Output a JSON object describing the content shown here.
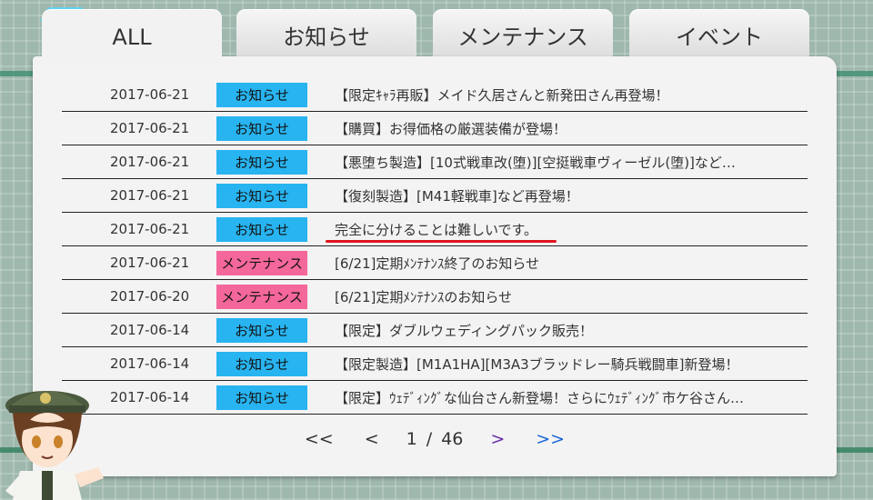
{
  "tabs": [
    {
      "label": "ALL",
      "active": true
    },
    {
      "label": "お知らせ",
      "active": false
    },
    {
      "label": "メンテナンス",
      "active": false
    },
    {
      "label": "イベント",
      "active": false
    }
  ],
  "news": [
    {
      "date": "2017-06-21",
      "category": "お知らせ",
      "type": "info",
      "title": "【限定ｷｬﾗ再販】メイド久居さんと新発田さん再登場！"
    },
    {
      "date": "2017-06-21",
      "category": "お知らせ",
      "type": "info",
      "title": "【購買】お得価格の厳選装備が登場！"
    },
    {
      "date": "2017-06-21",
      "category": "お知らせ",
      "type": "info",
      "title": "【悪堕ち製造】[10式戦車改(堕)][空挺戦車ヴィーゼル(堕)]など…"
    },
    {
      "date": "2017-06-21",
      "category": "お知らせ",
      "type": "info",
      "title": "【復刻製造】[M41軽戦車]など再登場！"
    },
    {
      "date": "2017-06-21",
      "category": "お知らせ",
      "type": "info",
      "title": "完全に分けることは難しいです。"
    },
    {
      "date": "2017-06-21",
      "category": "メンテナンス",
      "type": "maint",
      "title": "[6/21]定期ﾒﾝﾃﾅﾝｽ終了のお知らせ"
    },
    {
      "date": "2017-06-20",
      "category": "メンテナンス",
      "type": "maint",
      "title": "[6/21]定期ﾒﾝﾃﾅﾝｽのお知らせ"
    },
    {
      "date": "2017-06-14",
      "category": "お知らせ",
      "type": "info",
      "title": "【限定】ダブルウェディングパック販売！"
    },
    {
      "date": "2017-06-14",
      "category": "お知らせ",
      "type": "info",
      "title": "【限定製造】[M1A1HA][M3A3ブラッドレー騎兵戦闘車]新登場！"
    },
    {
      "date": "2017-06-14",
      "category": "お知らせ",
      "type": "info",
      "title": "【限定】ｳｪﾃﾞｨﾝｸﾞな仙台さん新登場！さらにｳｪﾃﾞｨﾝｸﾞ市ケ谷さん…"
    }
  ],
  "pager": {
    "first": "<<",
    "prev": "<",
    "current": "1",
    "separator": "/",
    "total": "46",
    "next": ">",
    "last": ">>"
  },
  "colors": {
    "info_badge": "#28b4f0",
    "maint_badge": "#f4679b",
    "highlight_underline": "#e0141e"
  }
}
